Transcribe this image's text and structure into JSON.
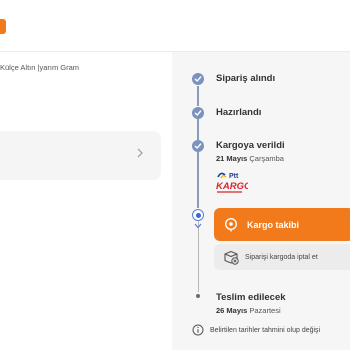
{
  "product": {
    "name": "Külçe Altın |yarım Gram"
  },
  "colors": {
    "accent": "#f27a1a",
    "timeline": "#7a92bd",
    "panel": "#f6f6f7"
  },
  "timeline": {
    "steps": [
      {
        "title": "Sipariş alındı",
        "status": "done",
        "icon": "check-icon"
      },
      {
        "title": "Hazırlandı",
        "status": "done",
        "icon": "check-icon"
      },
      {
        "title": "Kargoya verildi",
        "status": "done",
        "icon": "check-icon",
        "date_strong": "21 Mayıs",
        "date_rest": "Çarşamba",
        "carrier_logo": "ptt-kargo-logo"
      },
      {
        "title": "",
        "status": "current"
      },
      {
        "title": "Teslim edilecek",
        "status": "pending",
        "date_strong": "26 Mayıs",
        "date_rest": "Pazartesi"
      }
    ],
    "logo_text": {
      "top": "Ptt",
      "bottom": "KARGO"
    }
  },
  "actions": {
    "track_label": "Kargo takibi",
    "track_icon": "location-pin-icon",
    "cancel_text": "Siparişi kargoda iptal et",
    "cancel_icon": "package-cancel-icon"
  },
  "note": {
    "text": "Belirtilen tarihler tahmini olup değişi",
    "icon": "info-icon"
  }
}
